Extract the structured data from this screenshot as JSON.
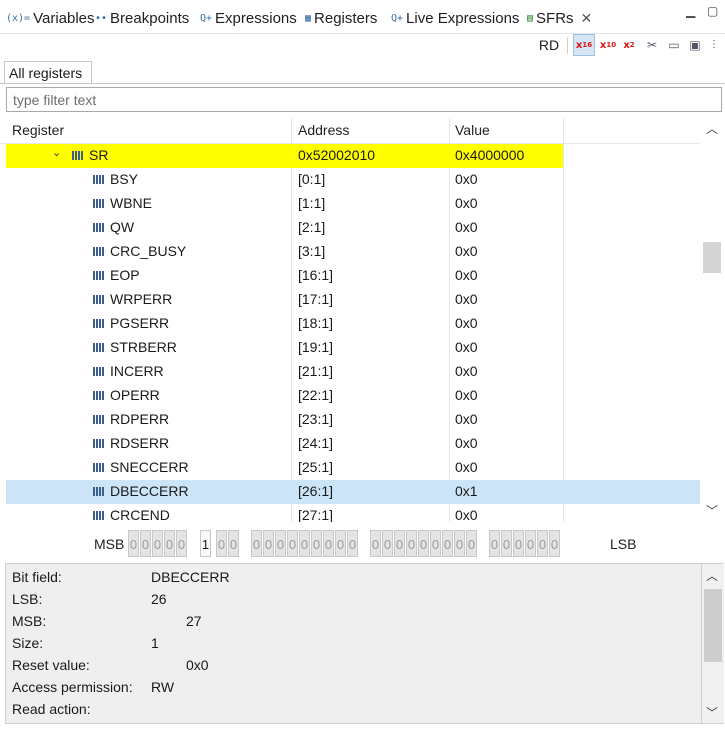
{
  "tabs": [
    {
      "icon": "(x)=",
      "label": "Variables"
    },
    {
      "icon": "••",
      "label": "Breakpoints"
    },
    {
      "icon": "Q+",
      "label": "Expressions"
    },
    {
      "icon": "▦",
      "label": "Registers"
    },
    {
      "icon": "Q+",
      "label": "Live Expressions"
    },
    {
      "icon": "▤",
      "label": "SFRs"
    }
  ],
  "toolbar": {
    "rd_label": "RD",
    "x16": "x",
    "x16_sub": "16",
    "x10": "x",
    "x10_sub": "10",
    "x2": "x",
    "x2_sub": "2"
  },
  "subtab_label": "All registers",
  "filter": {
    "placeholder": "type filter text"
  },
  "columns": {
    "register": "Register",
    "address": "Address",
    "value": "Value"
  },
  "register": {
    "name": "SR",
    "address": "0x52002010",
    "value": "0x4000000"
  },
  "fields": [
    {
      "name": "BSY",
      "address": "[0:1]",
      "value": "0x0"
    },
    {
      "name": "WBNE",
      "address": "[1:1]",
      "value": "0x0"
    },
    {
      "name": "QW",
      "address": "[2:1]",
      "value": "0x0"
    },
    {
      "name": "CRC_BUSY",
      "address": "[3:1]",
      "value": "0x0"
    },
    {
      "name": "EOP",
      "address": "[16:1]",
      "value": "0x0"
    },
    {
      "name": "WRPERR",
      "address": "[17:1]",
      "value": "0x0"
    },
    {
      "name": "PGSERR",
      "address": "[18:1]",
      "value": "0x0"
    },
    {
      "name": "STRBERR",
      "address": "[19:1]",
      "value": "0x0"
    },
    {
      "name": "INCERR",
      "address": "[21:1]",
      "value": "0x0"
    },
    {
      "name": "OPERR",
      "address": "[22:1]",
      "value": "0x0"
    },
    {
      "name": "RDPERR",
      "address": "[23:1]",
      "value": "0x0"
    },
    {
      "name": "RDSERR",
      "address": "[24:1]",
      "value": "0x0"
    },
    {
      "name": "SNECCERR",
      "address": "[25:1]",
      "value": "0x0"
    },
    {
      "name": "DBECCERR",
      "address": "[26:1]",
      "value": "0x1"
    },
    {
      "name": "CRCEND",
      "address": "[27:1]",
      "value": "0x0"
    }
  ],
  "bitbar": {
    "msb": "MSB",
    "lsb": "LSB",
    "bits": [
      "0",
      "0",
      "0",
      "0",
      "0",
      "1",
      "0",
      "0",
      "0",
      "0",
      "0",
      "0",
      "0",
      "0",
      "0",
      "0",
      "0",
      "0",
      "0",
      "0",
      "0",
      "0",
      "0",
      "0",
      "0",
      "0",
      "0",
      "0",
      "0",
      "0",
      "0",
      "0"
    ]
  },
  "details": {
    "bit_field_label": "Bit field:",
    "bit_field_value": "DBECCERR",
    "lsb_label": "LSB:",
    "lsb_value": "26",
    "msb_label": "MSB:",
    "msb_value": "27",
    "size_label": "Size:",
    "size_value": "1",
    "reset_label": "Reset value:",
    "reset_value": "0x0",
    "access_label": "Access permission:",
    "access_value": "RW",
    "read_label": "Read action:",
    "read_value": ""
  }
}
